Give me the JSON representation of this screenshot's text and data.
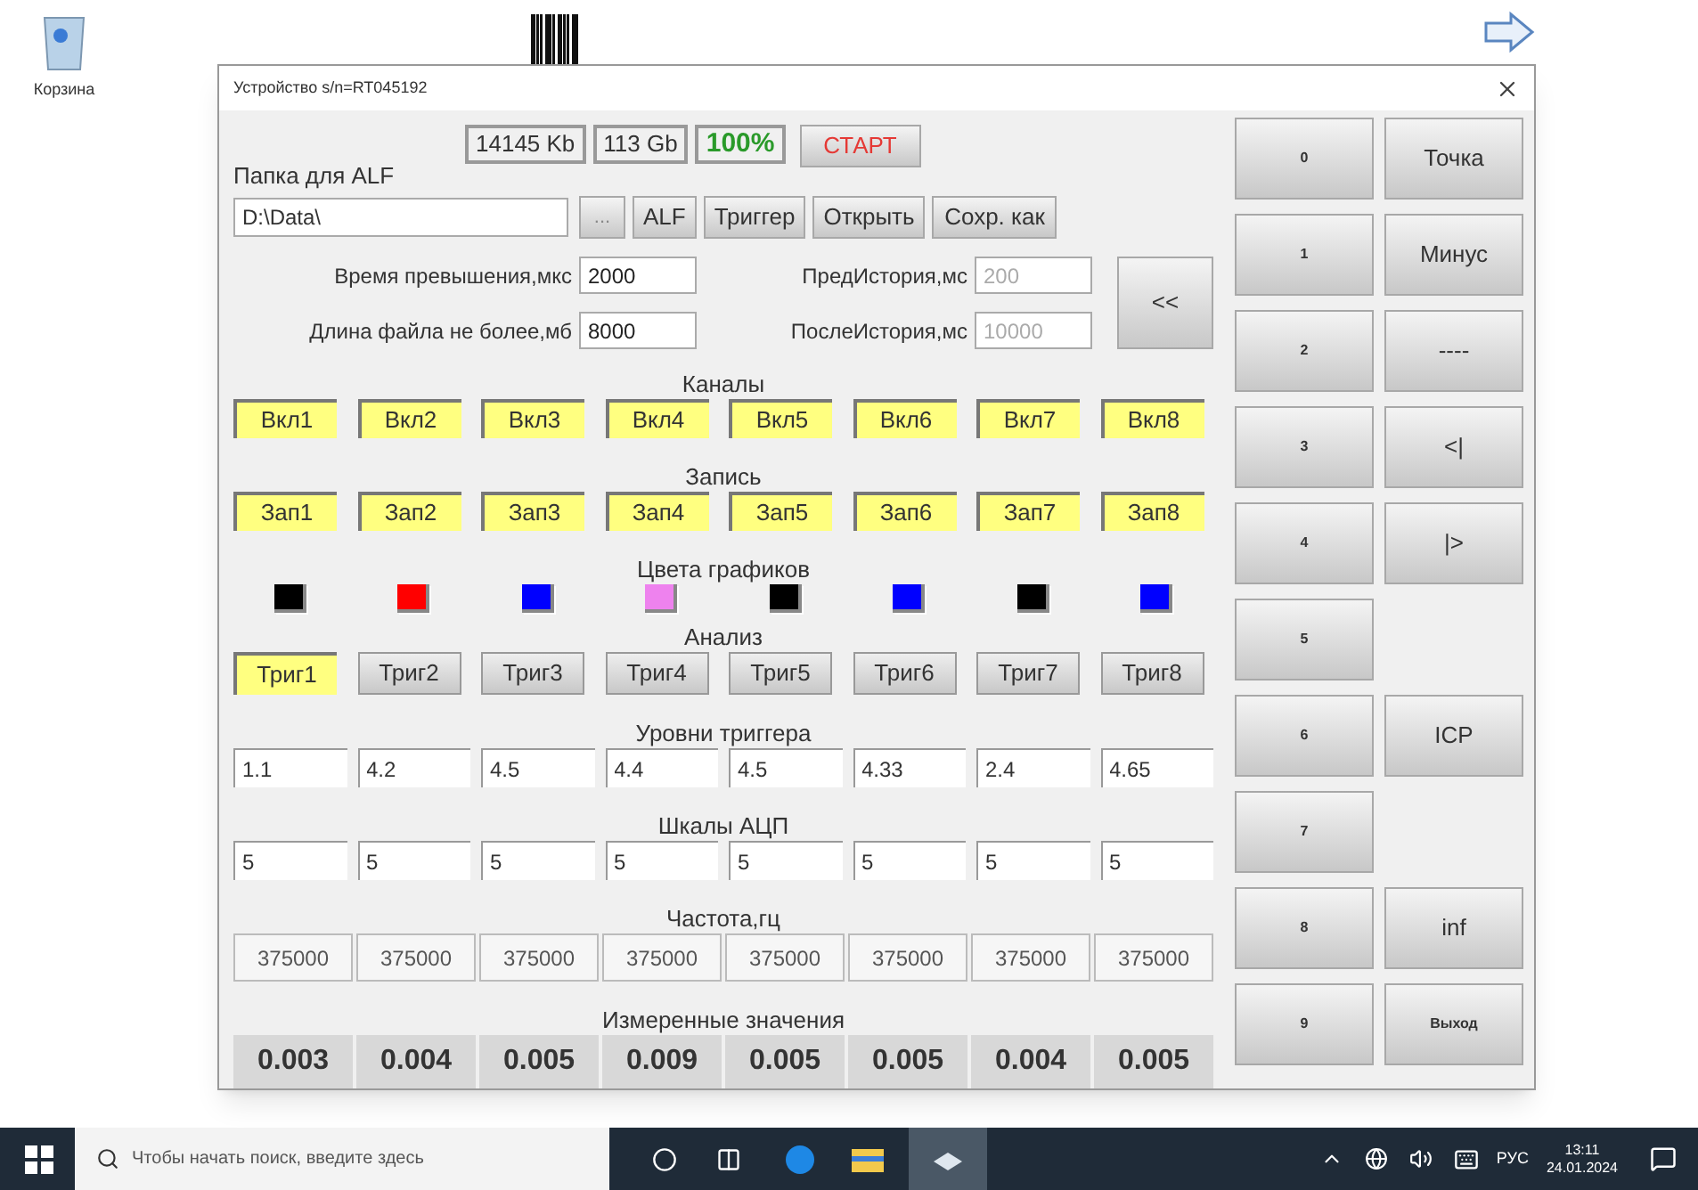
{
  "desktop": {
    "icons": [
      {
        "label": "Корзина"
      }
    ]
  },
  "window": {
    "title": "Устройство s/n=RT045192",
    "stats": [
      {
        "text": "14145 Kb",
        "kind": "plain"
      },
      {
        "text": "113 Gb",
        "kind": "plain"
      },
      {
        "text": "100%",
        "kind": "status"
      }
    ],
    "start_button": "СТАРТ",
    "folder_label": "Папка для ALF",
    "folder_path": "D:\\Data\\",
    "browse_button": "...",
    "buttons": [
      "ALF",
      "Триггер",
      "Открыть",
      "Сохр. как"
    ],
    "fields_left": [
      {
        "label": "Время превышения,мкс",
        "value": "2000",
        "disabled": false
      },
      {
        "label": "Длина файла не более,мб",
        "value": "8000",
        "disabled": false
      }
    ],
    "fields_right": [
      {
        "label": "ПредИстория,мс",
        "value": "200",
        "disabled": true
      },
      {
        "label": "ПослеИстория,мс",
        "value": "10000",
        "disabled": true
      }
    ],
    "back_button": "<<",
    "channels": {
      "title": "Каналы",
      "items": [
        {
          "label": "Вкл1",
          "on": true
        },
        {
          "label": "Вкл2",
          "on": true
        },
        {
          "label": "Вкл3",
          "on": true
        },
        {
          "label": "Вкл4",
          "on": true
        },
        {
          "label": "Вкл5",
          "on": true
        },
        {
          "label": "Вкл6",
          "on": true
        },
        {
          "label": "Вкл7",
          "on": true
        },
        {
          "label": "Вкл8",
          "on": true
        }
      ]
    },
    "record": {
      "title": "Запись",
      "items": [
        {
          "label": "Зап1",
          "on": true
        },
        {
          "label": "Зап2",
          "on": true
        },
        {
          "label": "Зап3",
          "on": true
        },
        {
          "label": "Зап4",
          "on": true
        },
        {
          "label": "Зап5",
          "on": true
        },
        {
          "label": "Зап6",
          "on": true
        },
        {
          "label": "Зап7",
          "on": true
        },
        {
          "label": "Зап8",
          "on": true
        }
      ]
    },
    "plot_colors": {
      "title": "Цвета графиков",
      "items": [
        {
          "color": "#000000"
        },
        {
          "color": "#ff0000"
        },
        {
          "color": "#0000ff"
        },
        {
          "color": "#ee82ee"
        },
        {
          "color": "#000000"
        },
        {
          "color": "#0000ff"
        },
        {
          "color": "#000000"
        },
        {
          "color": "#0000ff"
        }
      ]
    },
    "analysis": {
      "title": "Анализ",
      "items": [
        {
          "label": "Триг1",
          "selected": true
        },
        {
          "label": "Триг2",
          "selected": false
        },
        {
          "label": "Триг3",
          "selected": false
        },
        {
          "label": "Триг4",
          "selected": false
        },
        {
          "label": "Триг5",
          "selected": false
        },
        {
          "label": "Триг6",
          "selected": false
        },
        {
          "label": "Триг7",
          "selected": false
        },
        {
          "label": "Триг8",
          "selected": false
        }
      ]
    },
    "trigger_levels": {
      "title": "Уровни триггера",
      "values": [
        "1.1",
        "4.2",
        "4.5",
        "4.4",
        "4.5",
        "4.33",
        "2.4",
        "4.65"
      ]
    },
    "adc_scales": {
      "title": "Шкалы АЦП",
      "values": [
        "5",
        "5",
        "5",
        "5",
        "5",
        "5",
        "5",
        "5"
      ]
    },
    "frequency": {
      "title": "Частота,гц",
      "values": [
        "375000",
        "375000",
        "375000",
        "375000",
        "375000",
        "375000",
        "375000",
        "375000"
      ]
    },
    "measured": {
      "title": "Измеренные значения",
      "values": [
        "0.003",
        "0.004",
        "0.005",
        "0.009",
        "0.005",
        "0.005",
        "0.004",
        "0.005"
      ]
    },
    "keypad": [
      {
        "digit": "0",
        "function": "Точка"
      },
      {
        "digit": "1",
        "function": "Минус"
      },
      {
        "digit": "2",
        "function": "----"
      },
      {
        "digit": "3",
        "function": "<|"
      },
      {
        "digit": "4",
        "function": "|>"
      },
      {
        "digit": "5"
      },
      {
        "digit": "6",
        "function": "ICP"
      },
      {
        "digit": "7"
      },
      {
        "digit": "8",
        "function": "inf"
      },
      {
        "digit": "9",
        "function": "Выход"
      }
    ]
  },
  "taskbar": {
    "search_placeholder": "Чтобы начать поиск, введите здесь",
    "language": "РУС",
    "time": "13:11",
    "date": "24.01.2024"
  }
}
